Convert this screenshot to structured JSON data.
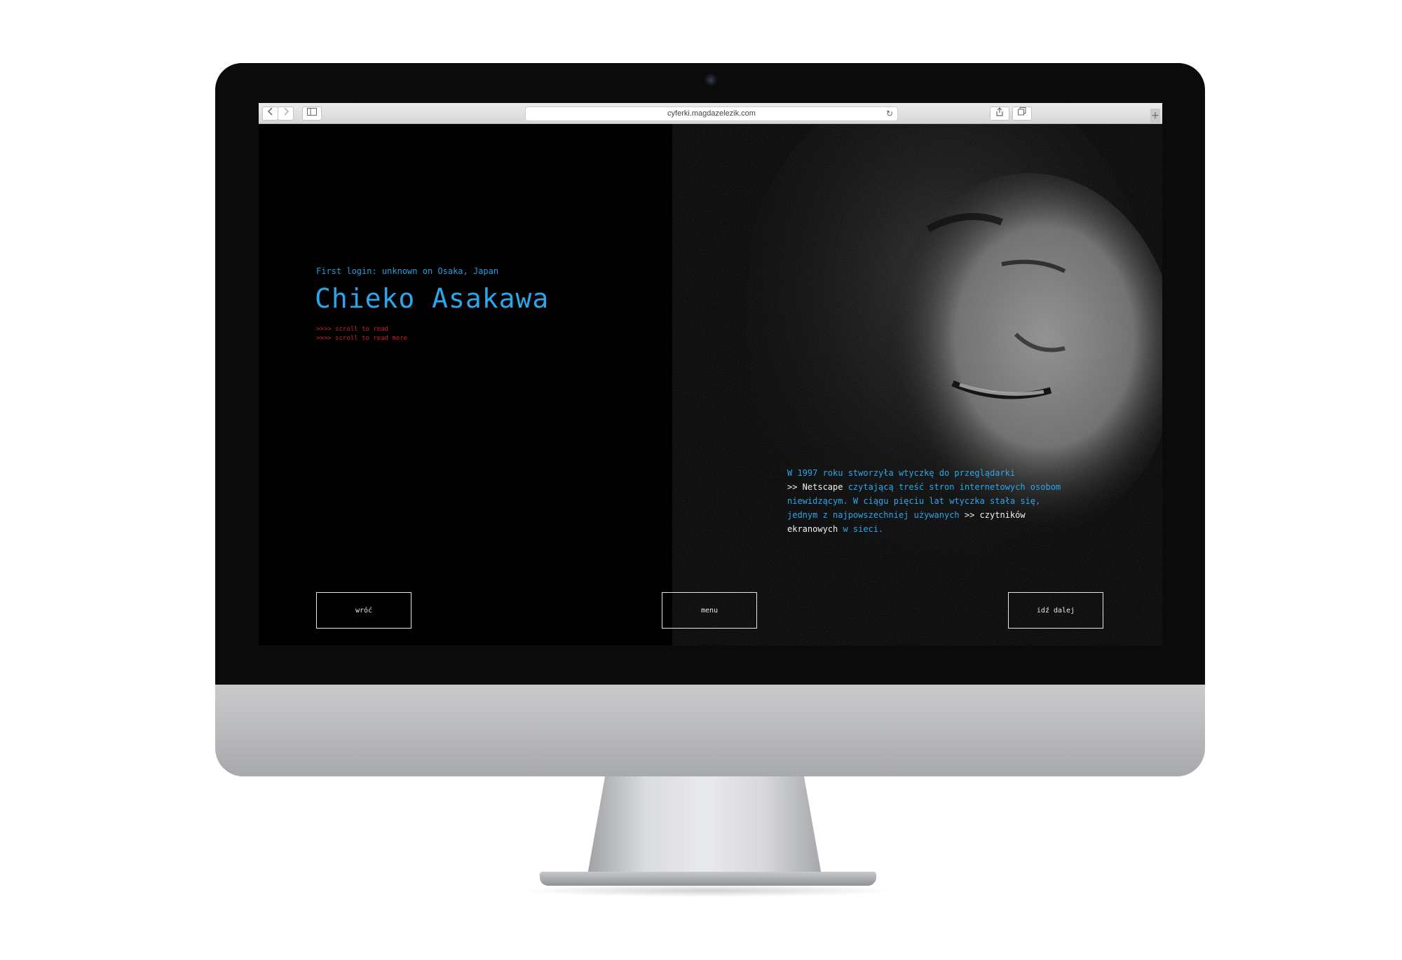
{
  "browser": {
    "url": "cyferki.magdazelezik.com",
    "back_icon": "chevron-left-icon",
    "forward_icon": "chevron-right-icon",
    "sidebar_icon": "sidebar-icon",
    "reload_icon": "reload-icon",
    "share_icon": "share-icon",
    "tabs_icon": "tabs-icon",
    "new_tab_icon": "plus-icon"
  },
  "page": {
    "login_line": "First login: unknown on Osaka, Japan",
    "name": "Chieko Asakawa",
    "scroll_hints": [
      ">>>> scroll to read",
      ">>>> scroll to read more"
    ],
    "story": {
      "line1": "W 1997 roku stworzyła wtyczkę do przeglądarki",
      "line2_prefix": ">> Netscape",
      "line2_rest": " czytającą treść stron internetowych osobom",
      "line3": "niewidzącym. W ciągu pięciu lat wtyczka stała się,",
      "line4_a": "jednym z najpowszechniej używanych",
      "line4_b": " >> czytników",
      "line5_a": "ekranowych",
      "line5_b": " w sieci."
    },
    "buttons": {
      "back": "wróć",
      "menu": "menu",
      "next": "idź dalej"
    }
  },
  "colors": {
    "accent_blue": "#2aa7ea",
    "hint_red": "#d1202a",
    "background": "#000000"
  }
}
